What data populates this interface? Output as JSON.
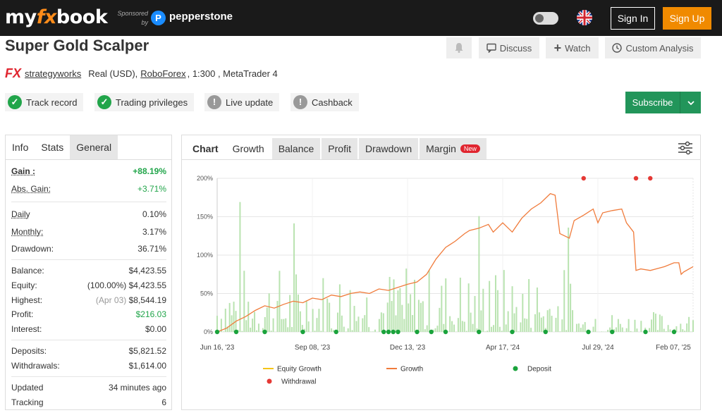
{
  "header": {
    "logo_my": "my",
    "logo_fx": "fx",
    "logo_book": "book",
    "sponsored": "Sponsored",
    "by": "by",
    "sponsor_mark": "P",
    "sponsor_name": "pepperstone",
    "sign_in": "Sign In",
    "sign_up": "Sign Up"
  },
  "system": {
    "title": "Super Gold Scalper",
    "fx_badge": "FX",
    "owner": "strategyworks",
    "account_type": "Real (USD),",
    "broker": "RoboForex",
    "details": ", 1:300 , MetaTrader 4",
    "actions": {
      "discuss": "Discuss",
      "watch": "Watch",
      "custom_analysis": "Custom Analysis"
    },
    "badges": [
      "Track record",
      "Trading privileges",
      "Live update",
      "Cashback"
    ],
    "subscribe": "Subscribe"
  },
  "left_tabs": [
    "Info",
    "Stats",
    "General"
  ],
  "stats": {
    "gain_label": "Gain :",
    "gain_value": "+88.19%",
    "abs_gain_label": "Abs. Gain:",
    "abs_gain_value": "+3.71%",
    "daily_label": "Daily",
    "daily_value": "0.10%",
    "monthly_label": "Monthly:",
    "monthly_value": "3.17%",
    "drawdown_label": "Drawdown:",
    "drawdown_value": "36.71%",
    "balance_label": "Balance:",
    "balance_value": "$4,423.55",
    "equity_label": "Equity:",
    "equity_pct": "(100.00%)",
    "equity_value": "$4,423.55",
    "highest_label": "Highest:",
    "highest_date": "(Apr 03)",
    "highest_value": "$8,544.19",
    "profit_label": "Profit:",
    "profit_value": "$216.03",
    "interest_label": "Interest:",
    "interest_value": "$0.00",
    "deposits_label": "Deposits:",
    "deposits_value": "$5,821.52",
    "withdrawals_label": "Withdrawals:",
    "withdrawals_value": "$1,614.00",
    "updated_label": "Updated",
    "updated_value": "34 minutes ago",
    "tracking_label": "Tracking",
    "tracking_value": "6"
  },
  "chart_tabs": [
    "Chart",
    "Growth",
    "Balance",
    "Profit",
    "Drawdown",
    "Margin"
  ],
  "new_badge": "New",
  "colors": {
    "growth": "#f07b3b",
    "equity": "#f5c518",
    "deposit": "#1aa33c",
    "withdrawal": "#e53935",
    "volume": "#b9e3b0"
  },
  "chart_data": {
    "type": "line",
    "y_ticks": [
      "200%",
      "150%",
      "100%",
      "50%",
      "0%"
    ],
    "ylim": [
      0,
      200
    ],
    "x_ticks": [
      "Jun 16, '23",
      "Sep 08, '23",
      "Dec 13, '23",
      "Apr 17, '24",
      "Jul 29, '24",
      "Feb 07, '25"
    ],
    "series": [
      {
        "name": "Growth",
        "points": [
          [
            0,
            0
          ],
          [
            0.02,
            5
          ],
          [
            0.04,
            14
          ],
          [
            0.06,
            20
          ],
          [
            0.08,
            28
          ],
          [
            0.1,
            34
          ],
          [
            0.12,
            31
          ],
          [
            0.14,
            36
          ],
          [
            0.16,
            40
          ],
          [
            0.18,
            38
          ],
          [
            0.2,
            44
          ],
          [
            0.22,
            42
          ],
          [
            0.24,
            48
          ],
          [
            0.26,
            46
          ],
          [
            0.28,
            50
          ],
          [
            0.3,
            52
          ],
          [
            0.32,
            50
          ],
          [
            0.34,
            56
          ],
          [
            0.36,
            54
          ],
          [
            0.38,
            58
          ],
          [
            0.4,
            62
          ],
          [
            0.42,
            65
          ],
          [
            0.44,
            75
          ],
          [
            0.46,
            95
          ],
          [
            0.48,
            110
          ],
          [
            0.5,
            118
          ],
          [
            0.52,
            128
          ],
          [
            0.53,
            132
          ],
          [
            0.55,
            135
          ],
          [
            0.57,
            140
          ],
          [
            0.58,
            130
          ],
          [
            0.6,
            142
          ],
          [
            0.62,
            130
          ],
          [
            0.64,
            148
          ],
          [
            0.66,
            160
          ],
          [
            0.68,
            168
          ],
          [
            0.7,
            180
          ],
          [
            0.71,
            178
          ],
          [
            0.72,
            128
          ],
          [
            0.74,
            122
          ],
          [
            0.75,
            145
          ],
          [
            0.77,
            152
          ],
          [
            0.79,
            160
          ],
          [
            0.8,
            142
          ],
          [
            0.81,
            155
          ],
          [
            0.83,
            158
          ],
          [
            0.85,
            160
          ],
          [
            0.86,
            142
          ],
          [
            0.875,
            130
          ],
          [
            0.88,
            80
          ],
          [
            0.89,
            82
          ],
          [
            0.91,
            80
          ],
          [
            0.94,
            85
          ],
          [
            0.96,
            90
          ],
          [
            0.97,
            90
          ],
          [
            0.975,
            75
          ],
          [
            0.98,
            78
          ],
          [
            1.0,
            85
          ]
        ]
      },
      {
        "name": "Equity Growth",
        "points": []
      }
    ],
    "deposits_x": [
      0.0,
      0.04,
      0.1,
      0.18,
      0.25,
      0.35,
      0.36,
      0.37,
      0.38,
      0.42,
      0.45,
      0.48,
      0.55,
      0.62,
      0.69,
      0.78,
      0.83,
      0.9,
      0.96
    ],
    "withdrawals_x": [
      0.77,
      0.88,
      0.91
    ],
    "legend": [
      "Equity Growth",
      "Growth",
      "Deposit",
      "Withdrawal"
    ]
  }
}
